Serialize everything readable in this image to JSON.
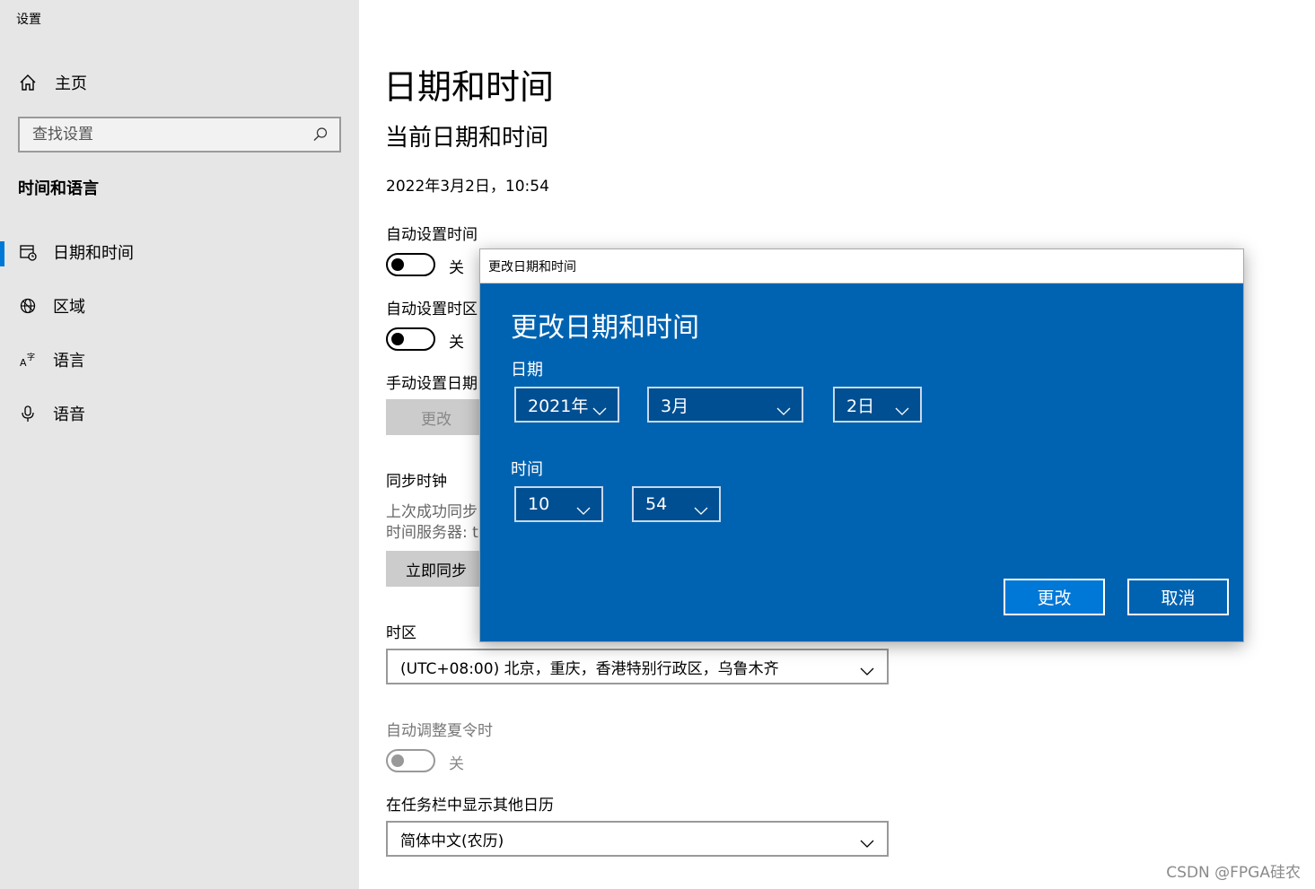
{
  "app": {
    "title": "设置"
  },
  "sidebar": {
    "home_label": "主页",
    "search_placeholder": "查找设置",
    "section_title": "时间和语言",
    "items": [
      {
        "label": "日期和时间",
        "icon": "calendar-clock-icon",
        "active": true
      },
      {
        "label": "区域",
        "icon": "globe-icon",
        "active": false
      },
      {
        "label": "语言",
        "icon": "language-icon",
        "active": false
      },
      {
        "label": "语音",
        "icon": "microphone-icon",
        "active": false
      }
    ]
  },
  "main": {
    "title": "日期和时间",
    "subtitle": "当前日期和时间",
    "current_datetime": "2022年3月2日，10:54",
    "auto_time": {
      "label": "自动设置时间",
      "state": "关"
    },
    "auto_timezone": {
      "label": "自动设置时区",
      "state": "关"
    },
    "manual": {
      "label": "手动设置日期",
      "button": "更改"
    },
    "sync": {
      "label": "同步时钟",
      "line1": "上次成功同步",
      "line2": "时间服务器: ti",
      "button": "立即同步"
    },
    "timezone": {
      "label": "时区",
      "value": "(UTC+08:00) 北京，重庆，香港特别行政区，乌鲁木齐"
    },
    "dst": {
      "label": "自动调整夏令时",
      "state": "关"
    },
    "calendar": {
      "label": "在任务栏中显示其他日历",
      "value": "简体中文(农历)"
    }
  },
  "dialog": {
    "window_title": "更改日期和时间",
    "heading": "更改日期和时间",
    "date_label": "日期",
    "year": "2021年",
    "month": "3月",
    "day": "2日",
    "time_label": "时间",
    "hour": "10",
    "minute": "54",
    "change_button": "更改",
    "cancel_button": "取消"
  },
  "watermark": "CSDN @FPGA硅农",
  "colors": {
    "accent": "#0078d7",
    "dialog_bg": "#0063b1",
    "sidebar_bg": "#e6e6e6"
  }
}
